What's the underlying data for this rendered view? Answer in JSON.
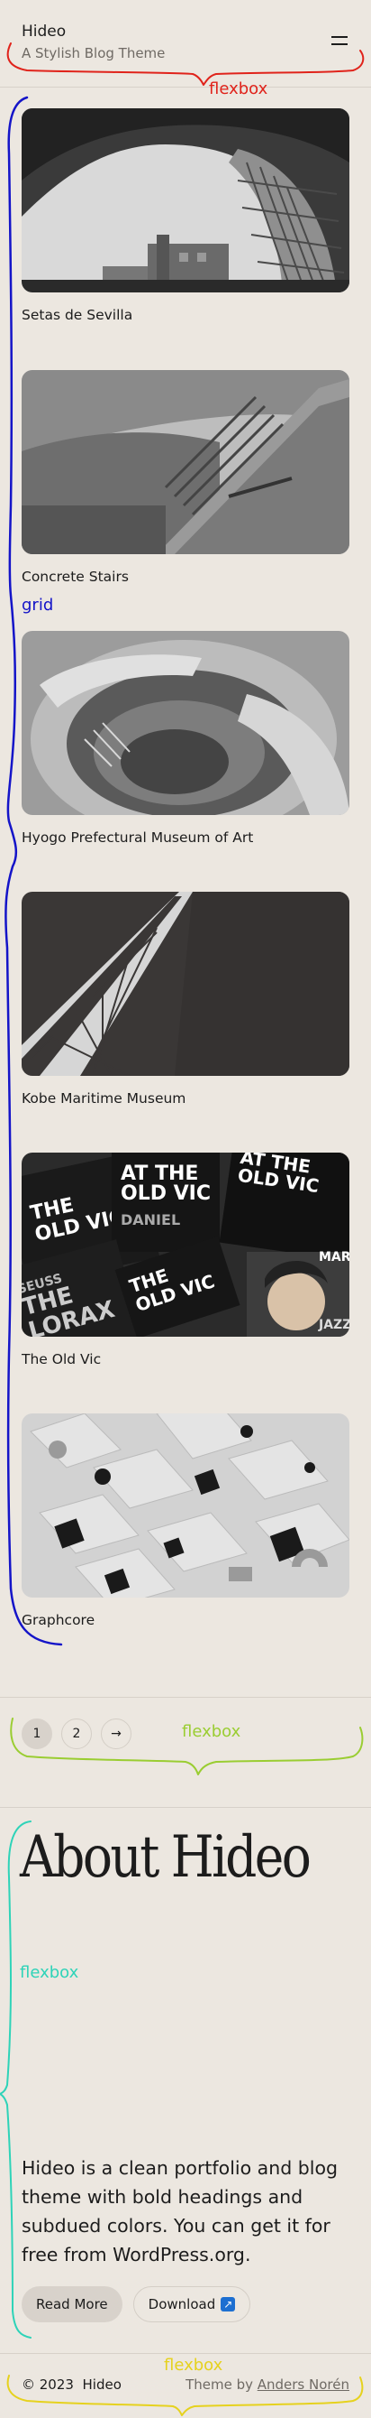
{
  "header": {
    "site_title": "Hideo",
    "tagline": "A Stylish Blog Theme",
    "menu_icon": "hamburger-icon"
  },
  "posts": [
    {
      "title": "Setas de Sevilla"
    },
    {
      "title": "Concrete Stairs"
    },
    {
      "title": "Hyogo Prefectural Museum of Art"
    },
    {
      "title": "Kobe Maritime Museum"
    },
    {
      "title": "The Old Vic"
    },
    {
      "title": "Graphcore"
    }
  ],
  "poster_text": {
    "line1": "THE",
    "line2": "OLD VIC",
    "line3": "AT THE",
    "line4": "OLD VIC",
    "line5": "DANIEL",
    "line6": "SEUSS",
    "line7": "THE",
    "line8": "LORAX",
    "line9": "MARY",
    "line10": "JAZZ"
  },
  "pagination": {
    "pages": [
      "1",
      "2"
    ],
    "next": "→",
    "current": "1"
  },
  "about": {
    "heading": "About Hideo",
    "text": "Hideo is a clean portfolio and blog theme with bold headings and subdued colors. You can get it for free from WordPress.org.",
    "read_more": "Read More",
    "download": "Download",
    "download_icon": "external-link-icon"
  },
  "footer": {
    "copyright": "© 2023",
    "site_name": "Hideo",
    "credit_prefix": "Theme by",
    "credit_author": "Anders Norén"
  },
  "annotations": {
    "flexbox_header": "flexbox",
    "grid": "grid",
    "flexbox_pagination": "flexbox",
    "flexbox_about": "flexbox",
    "flexbox_footer": "flexbox",
    "colors": {
      "red": "#e0231b",
      "blue": "#1414c8",
      "green": "#9acd32",
      "teal": "#2ed3b8",
      "yellow": "#e6d21e"
    }
  }
}
